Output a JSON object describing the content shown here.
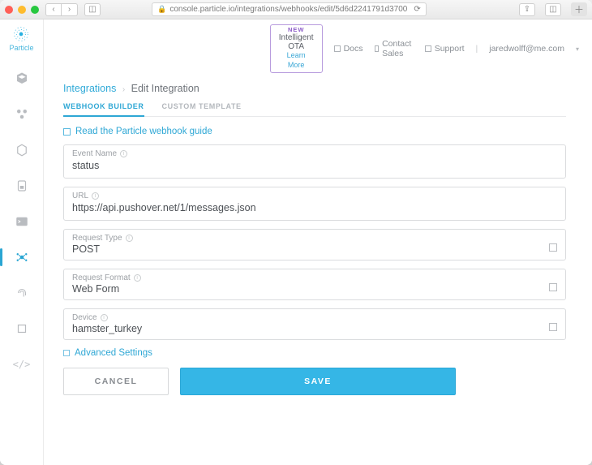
{
  "browser": {
    "url": "console.particle.io/integrations/webhooks/edit/5d6d2241791d3700",
    "reload_icon": "reload",
    "share_icon": "share",
    "tabs_icon": "tabs",
    "newtab_icon": "plus"
  },
  "header": {
    "promo_badge": "NEW",
    "promo_title": "Intelligent OTA",
    "promo_link": "Learn More",
    "links": {
      "docs": "Docs",
      "contact": "Contact Sales",
      "support": "Support"
    },
    "user_email": "jaredwolff@me.com"
  },
  "sidebar": {
    "brand": "Particle"
  },
  "crumbs": {
    "root": "Integrations",
    "current": "Edit Integration"
  },
  "tabs": {
    "builder": "WEBHOOK BUILDER",
    "custom": "CUSTOM TEMPLATE"
  },
  "guide_text": "Read the Particle webhook guide",
  "fields": {
    "event": {
      "label": "Event Name",
      "value": "status"
    },
    "url": {
      "label": "URL",
      "value": "https://api.pushover.net/1/messages.json"
    },
    "reqtype": {
      "label": "Request Type",
      "value": "POST"
    },
    "reqfmt": {
      "label": "Request Format",
      "value": "Web Form"
    },
    "device": {
      "label": "Device",
      "value": "hamster_turkey"
    }
  },
  "advanced_label": "Advanced Settings",
  "buttons": {
    "cancel": "CANCEL",
    "save": "SAVE"
  }
}
